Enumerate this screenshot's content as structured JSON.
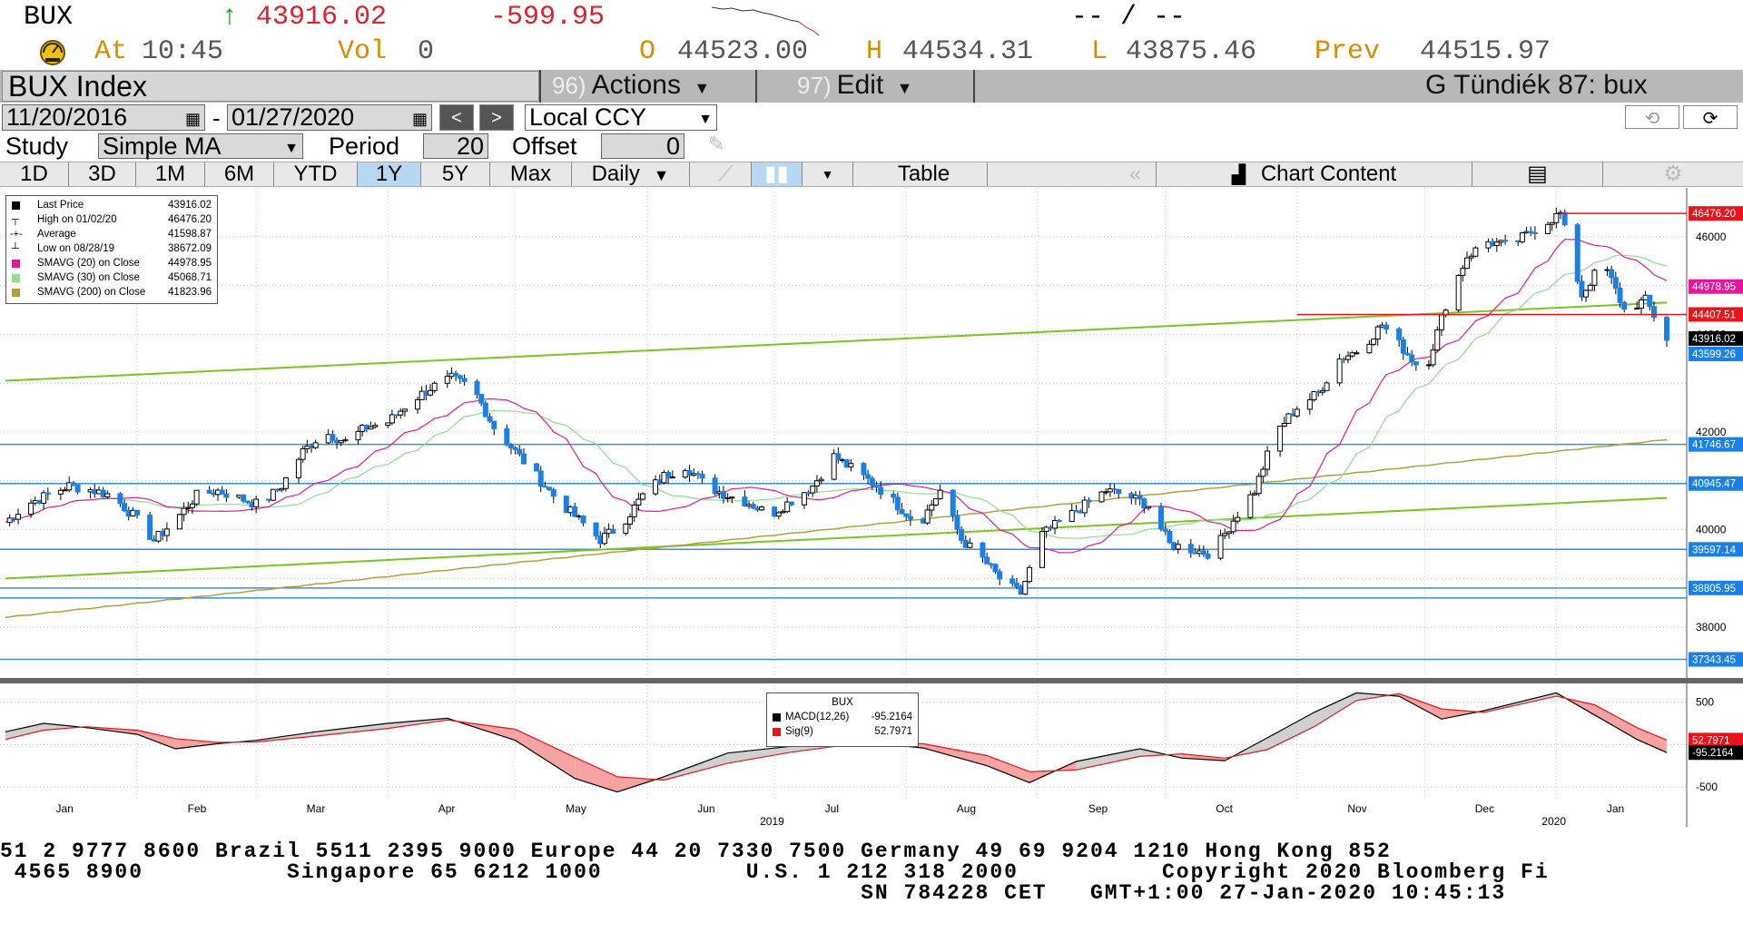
{
  "quote": {
    "ticker": "BUX",
    "arrow": "↑",
    "last": "43916.02",
    "change": "-599.95",
    "bid_ask": "-- / --",
    "at_label": "At",
    "time": "10:45",
    "vol_label": "Vol",
    "vol": "0",
    "open_label": "O",
    "open": "44523.00",
    "high_label": "H",
    "high": "44534.31",
    "low_label": "L",
    "low": "43875.46",
    "prev_label": "Prev",
    "prev": "44515.97"
  },
  "titlebar": {
    "security": "BUX Index",
    "actions_num": "96)",
    "actions": "Actions",
    "edit_num": "97)",
    "edit": "Edit",
    "function": "G Tündiék 87: bux"
  },
  "controls": {
    "start_date": "11/20/2016",
    "date_sep": "-",
    "end_date": "01/27/2020",
    "currency": "Local CCY",
    "study_label": "Study",
    "study": "Simple MA",
    "period_label": "Period",
    "period": "20",
    "offset_label": "Offset",
    "offset": "0"
  },
  "tabs": {
    "ranges": [
      "1D",
      "3D",
      "1M",
      "6M",
      "YTD",
      "1Y",
      "5Y",
      "Max"
    ],
    "active": "1Y",
    "frequency": "Daily",
    "table": "Table",
    "chart_content": "Chart Content"
  },
  "colors": {
    "candle": "#1a80e6",
    "sma20": "#e6189a",
    "sma30": "#8ee08e",
    "sma200": "#b0a23a",
    "trend": "#7ac520",
    "hline": "#3a8fd9",
    "redline": "#e8141c",
    "macd_fill": "#f5a3a3",
    "macd_fill_up": "#d0d0d0"
  },
  "chart_data": [
    {
      "type": "candlestick",
      "title": "",
      "ylim": [
        37000,
        47000
      ],
      "y_ticks": [
        38000,
        40000,
        42000,
        44000,
        46000
      ],
      "y_tick_labels": [
        "38000",
        "40000",
        "42000",
        "44000",
        "46000"
      ],
      "x_labels": [
        "Jan",
        "Feb",
        "Mar",
        "Apr",
        "May",
        "Jun",
        "Jul",
        "Aug",
        "Sep",
        "Oct",
        "Nov",
        "Dec",
        "Jan"
      ],
      "year_labels": [
        {
          "month": "Jun",
          "label": "2019"
        },
        {
          "month": "Jan",
          "label": "2020"
        }
      ],
      "x_start": "2019-01-01",
      "x_end": "2020-01-27",
      "close_series": [
        [
          "2019-01-01",
          40150
        ],
        [
          "2019-01-06",
          40520
        ],
        [
          "2019-01-11",
          40710
        ],
        [
          "2019-01-16",
          40900
        ],
        [
          "2019-01-21",
          40820
        ],
        [
          "2019-01-26",
          40700
        ],
        [
          "2019-01-31",
          40300
        ],
        [
          "2019-02-05",
          39780
        ],
        [
          "2019-02-10",
          40200
        ],
        [
          "2019-02-15",
          40700
        ],
        [
          "2019-02-20",
          40800
        ],
        [
          "2019-02-25",
          40650
        ],
        [
          "2019-03-02",
          40500
        ],
        [
          "2019-03-07",
          40900
        ],
        [
          "2019-03-12",
          41600
        ],
        [
          "2019-03-17",
          42000
        ],
        [
          "2019-03-22",
          41800
        ],
        [
          "2019-03-27",
          42100
        ],
        [
          "2019-04-01",
          42200
        ],
        [
          "2019-04-06",
          42600
        ],
        [
          "2019-04-11",
          42900
        ],
        [
          "2019-04-16",
          43100
        ],
        [
          "2019-04-21",
          42900
        ],
        [
          "2019-04-26",
          42100
        ],
        [
          "2019-05-01",
          41600
        ],
        [
          "2019-05-06",
          41100
        ],
        [
          "2019-05-11",
          40600
        ],
        [
          "2019-05-16",
          40200
        ],
        [
          "2019-05-21",
          39800
        ],
        [
          "2019-05-26",
          40100
        ],
        [
          "2019-05-31",
          40700
        ],
        [
          "2019-06-05",
          41100
        ],
        [
          "2019-06-10",
          41300
        ],
        [
          "2019-06-15",
          40900
        ],
        [
          "2019-06-20",
          40700
        ],
        [
          "2019-06-25",
          40550
        ],
        [
          "2019-06-30",
          40300
        ],
        [
          "2019-07-05",
          40600
        ],
        [
          "2019-07-10",
          40900
        ],
        [
          "2019-07-15",
          41500
        ],
        [
          "2019-07-20",
          41200
        ],
        [
          "2019-07-25",
          40900
        ],
        [
          "2019-07-30",
          40500
        ],
        [
          "2019-08-04",
          40100
        ],
        [
          "2019-08-09",
          40800
        ],
        [
          "2019-08-14",
          39800
        ],
        [
          "2019-08-19",
          39400
        ],
        [
          "2019-08-24",
          38900
        ],
        [
          "2019-08-28",
          38700
        ],
        [
          "2019-09-02",
          39900
        ],
        [
          "2019-09-07",
          40200
        ],
        [
          "2019-09-12",
          40500
        ],
        [
          "2019-09-17",
          40800
        ],
        [
          "2019-09-22",
          40700
        ],
        [
          "2019-09-27",
          40500
        ],
        [
          "2019-10-02",
          39700
        ],
        [
          "2019-10-07",
          39600
        ],
        [
          "2019-10-12",
          39500
        ],
        [
          "2019-10-17",
          40200
        ],
        [
          "2019-10-22",
          40800
        ],
        [
          "2019-10-27",
          42000
        ],
        [
          "2019-11-01",
          42500
        ],
        [
          "2019-11-06",
          42800
        ],
        [
          "2019-11-11",
          43500
        ],
        [
          "2019-11-16",
          43700
        ],
        [
          "2019-11-21",
          44200
        ],
        [
          "2019-11-26",
          43700
        ],
        [
          "2019-12-01",
          43200
        ],
        [
          "2019-12-06",
          44600
        ],
        [
          "2019-12-11",
          45600
        ],
        [
          "2019-12-16",
          45900
        ],
        [
          "2019-12-21",
          45800
        ],
        [
          "2019-12-26",
          46100
        ],
        [
          "2020-01-02",
          46476
        ],
        [
          "2020-01-07",
          44800
        ],
        [
          "2020-01-12",
          45500
        ],
        [
          "2020-01-17",
          44500
        ],
        [
          "2020-01-22",
          44700
        ],
        [
          "2020-01-27",
          43916
        ]
      ],
      "series": [
        {
          "name": "Last Price",
          "value": "43916.02"
        },
        {
          "name": "High on 01/02/20",
          "value": "46476.20"
        },
        {
          "name": "Average",
          "value": "41598.87"
        },
        {
          "name": "Low on 08/28/19",
          "value": "38672.09"
        },
        {
          "name": "SMAVG (20)  on Close",
          "value": "44978.95"
        },
        {
          "name": "SMAVG (30)  on Close",
          "value": "45068.71"
        },
        {
          "name": "SMAVG (200)  on Close",
          "value": "41823.96"
        }
      ],
      "right_labels": [
        {
          "value": 46476.2,
          "label": "46476.20",
          "color": "#e8141c"
        },
        {
          "value": 44978.95,
          "label": "44978.95",
          "color": "#e6189a"
        },
        {
          "value": 44407.51,
          "label": "44407.51",
          "color": "#e8141c"
        },
        {
          "value": 43916.02,
          "label": "43916.02",
          "color": "#000000"
        },
        {
          "value": 43599.26,
          "label": "43599.26",
          "color": "#1a80e6"
        },
        {
          "value": 41746.67,
          "label": "41746.67",
          "color": "#1a80e6"
        },
        {
          "value": 40945.47,
          "label": "40945.47",
          "color": "#1a80e6"
        },
        {
          "value": 39597.14,
          "label": "39597.14",
          "color": "#1a80e6"
        },
        {
          "value": 38805.95,
          "label": "38805.95",
          "color": "#1a80e6"
        },
        {
          "value": 37343.45,
          "label": "37343.45",
          "color": "#1a80e6"
        }
      ],
      "horizontal_lines": [
        41746.67,
        40945.47,
        39597.14,
        38805.95,
        38600,
        37343.45
      ],
      "trend_lines": [
        {
          "from": [
            "2019-01-01",
            43050
          ],
          "to": [
            "2020-01-27",
            44650
          ]
        },
        {
          "from": [
            "2019-01-01",
            39000
          ],
          "to": [
            "2020-01-27",
            40650
          ]
        }
      ]
    },
    {
      "type": "line",
      "title": "BUX",
      "ylim": [
        -650,
        700
      ],
      "y_ticks": [
        -500,
        500
      ],
      "y_tick_labels": [
        "-500",
        "500"
      ],
      "series": [
        {
          "name": "MACD(12,26)",
          "value": "-95.2164"
        },
        {
          "name": "Sig(9)",
          "value": "52.7971"
        }
      ],
      "right_labels": [
        {
          "value": 52.7971,
          "label": "52.7971",
          "color": "#e8141c"
        },
        {
          "value": -95.2164,
          "label": "-95.2164",
          "color": "#000000"
        }
      ],
      "macd": [
        [
          "2019-01-01",
          150
        ],
        [
          "2019-01-10",
          250
        ],
        [
          "2019-01-20",
          200
        ],
        [
          "2019-02-01",
          120
        ],
        [
          "2019-02-10",
          -50
        ],
        [
          "2019-02-20",
          10
        ],
        [
          "2019-03-01",
          50
        ],
        [
          "2019-03-15",
          150
        ],
        [
          "2019-04-01",
          250
        ],
        [
          "2019-04-15",
          310
        ],
        [
          "2019-05-01",
          50
        ],
        [
          "2019-05-15",
          -400
        ],
        [
          "2019-05-25",
          -560
        ],
        [
          "2019-06-05",
          -380
        ],
        [
          "2019-06-20",
          -100
        ],
        [
          "2019-07-05",
          -20
        ],
        [
          "2019-07-20",
          40
        ],
        [
          "2019-08-05",
          -40
        ],
        [
          "2019-08-20",
          -250
        ],
        [
          "2019-08-30",
          -450
        ],
        [
          "2019-09-10",
          -200
        ],
        [
          "2019-09-25",
          -50
        ],
        [
          "2019-10-05",
          -160
        ],
        [
          "2019-10-15",
          -190
        ],
        [
          "2019-10-25",
          80
        ],
        [
          "2019-11-05",
          380
        ],
        [
          "2019-11-15",
          610
        ],
        [
          "2019-11-25",
          570
        ],
        [
          "2019-12-05",
          300
        ],
        [
          "2019-12-15",
          400
        ],
        [
          "2020-01-01",
          610
        ],
        [
          "2020-01-10",
          350
        ],
        [
          "2020-01-20",
          60
        ],
        [
          "2020-01-27",
          -95
        ]
      ],
      "signal": [
        [
          "2019-01-01",
          60
        ],
        [
          "2019-01-10",
          170
        ],
        [
          "2019-01-20",
          210
        ],
        [
          "2019-02-01",
          170
        ],
        [
          "2019-02-10",
          70
        ],
        [
          "2019-02-20",
          25
        ],
        [
          "2019-03-01",
          30
        ],
        [
          "2019-03-15",
          100
        ],
        [
          "2019-04-01",
          190
        ],
        [
          "2019-04-15",
          290
        ],
        [
          "2019-05-01",
          180
        ],
        [
          "2019-05-15",
          -150
        ],
        [
          "2019-05-25",
          -380
        ],
        [
          "2019-06-05",
          -420
        ],
        [
          "2019-06-20",
          -220
        ],
        [
          "2019-07-05",
          -90
        ],
        [
          "2019-07-20",
          10
        ],
        [
          "2019-08-05",
          10
        ],
        [
          "2019-08-20",
          -130
        ],
        [
          "2019-08-30",
          -320
        ],
        [
          "2019-09-10",
          -300
        ],
        [
          "2019-09-25",
          -140
        ],
        [
          "2019-10-05",
          -110
        ],
        [
          "2019-10-15",
          -160
        ],
        [
          "2019-10-25",
          -60
        ],
        [
          "2019-11-05",
          210
        ],
        [
          "2019-11-15",
          520
        ],
        [
          "2019-11-25",
          600
        ],
        [
          "2019-12-05",
          420
        ],
        [
          "2019-12-15",
          380
        ],
        [
          "2020-01-01",
          570
        ],
        [
          "2020-01-10",
          470
        ],
        [
          "2020-01-20",
          200
        ],
        [
          "2020-01-27",
          52.8
        ]
      ]
    }
  ],
  "footer": {
    "line1": "51 2 9777 8600 Brazil 5511 2395 9000 Europe 44 20 7330 7500 Germany 49 69 9204 1210 Hong Kong 852",
    "line2": " 4565 8900          Singapore 65 6212 1000          U.S. 1 212 318 2000          Copyright 2020 Bloomberg Fi",
    "line3": "                                                            SN 784228 CET   GMT+1:00 27-Jan-2020 10:45:13"
  }
}
